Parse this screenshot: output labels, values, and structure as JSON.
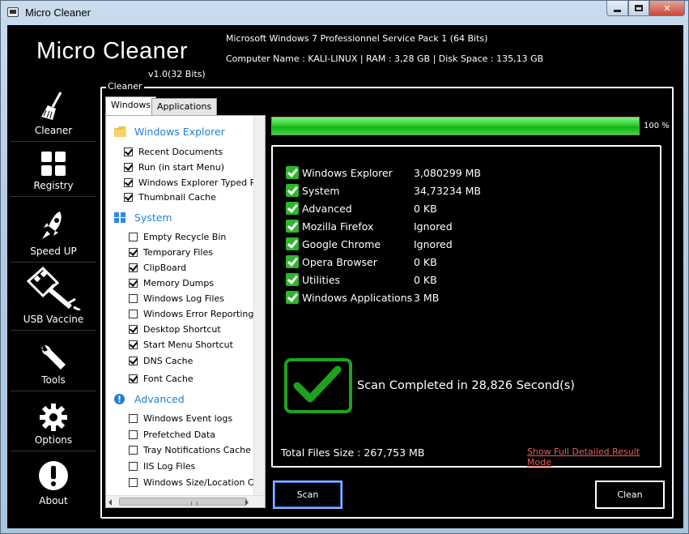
{
  "window": {
    "title": "Micro Cleaner",
    "close_glyph": "✕"
  },
  "header": {
    "app_title": "Micro Cleaner",
    "version": "v1.0(32 Bits)",
    "os_info": "Microsoft Windows 7 Professionnel Service Pack 1 (64 Bits)",
    "machine_info": "Computer Name : KALI-LINUX | RAM : 3,28 GB | Disk Space : 135,13 GB"
  },
  "sidebar": {
    "items": [
      {
        "label": "Cleaner",
        "icon": "broom-icon"
      },
      {
        "label": "Registry",
        "icon": "grid-icon"
      },
      {
        "label": "Speed UP",
        "icon": "rocket-icon"
      },
      {
        "label": "USB Vaccine",
        "icon": "usb-syringe-icon"
      },
      {
        "label": "Tools",
        "icon": "wrench-icon"
      },
      {
        "label": "Options",
        "icon": "gear-icon"
      },
      {
        "label": "About",
        "icon": "exclamation-icon"
      }
    ]
  },
  "group": {
    "legend": "Cleaner"
  },
  "tabs": {
    "windows": "Windows",
    "applications": "Applications"
  },
  "tree": {
    "categories": {
      "windows_explorer": "Windows Explorer",
      "system": "System",
      "advanced": "Advanced"
    },
    "windows_explorer_items": [
      {
        "label": "Recent Documents",
        "checked": true
      },
      {
        "label": "Run (in start Menu)",
        "checked": true
      },
      {
        "label": "Windows Explorer Typed Paths",
        "checked": true
      },
      {
        "label": "Thumbnail Cache",
        "checked": true
      }
    ],
    "system_items": [
      {
        "label": "Empty Recycle Bin",
        "checked": false
      },
      {
        "label": "Temporary Files",
        "checked": true
      },
      {
        "label": "ClipBoard",
        "checked": true
      },
      {
        "label": "Memory Dumps",
        "checked": true
      },
      {
        "label": "Windows Log Files",
        "checked": false
      },
      {
        "label": "Windows Error Reporting",
        "checked": false
      },
      {
        "label": "Desktop Shortcut",
        "checked": true
      },
      {
        "label": "Start Menu Shortcut",
        "checked": true
      },
      {
        "label": "DNS Cache",
        "checked": true
      },
      {
        "label": "Font Cache",
        "checked": true
      }
    ],
    "advanced_items": [
      {
        "label": "Windows Event logs",
        "checked": false
      },
      {
        "label": "Prefetched Data",
        "checked": false
      },
      {
        "label": "Tray Notifications Cache",
        "checked": false
      },
      {
        "label": "IIS Log Files",
        "checked": false
      },
      {
        "label": "Windows Size/Location Cache",
        "checked": false
      }
    ]
  },
  "progress": {
    "value": 100,
    "label": "100 %",
    "color": "#2fce2f"
  },
  "results": {
    "rows": [
      {
        "name": "Windows Explorer",
        "value": "3,080299 MB"
      },
      {
        "name": "System",
        "value": "34,73234 MB"
      },
      {
        "name": "Advanced",
        "value": "0 KB"
      },
      {
        "name": "Mozilla Firefox",
        "value": "Ignored"
      },
      {
        "name": "Google Chrome",
        "value": "Ignored"
      },
      {
        "name": "Opera Browser",
        "value": "0 KB"
      },
      {
        "name": "Utilities",
        "value": "0 KB"
      },
      {
        "name": "Windows Applications",
        "value": "3 MB"
      }
    ],
    "scan_complete": "Scan Completed in 28,826 Second(s)",
    "total_size": "Total Files Size : 267,753 MB",
    "detail_link": "Show Full Detailed Result Mode"
  },
  "buttons": {
    "scan": "Scan",
    "clean": "Clean"
  },
  "colors": {
    "accent_blue": "#1e7fd6",
    "success_green": "#2db52d",
    "link_red": "#e06060"
  }
}
